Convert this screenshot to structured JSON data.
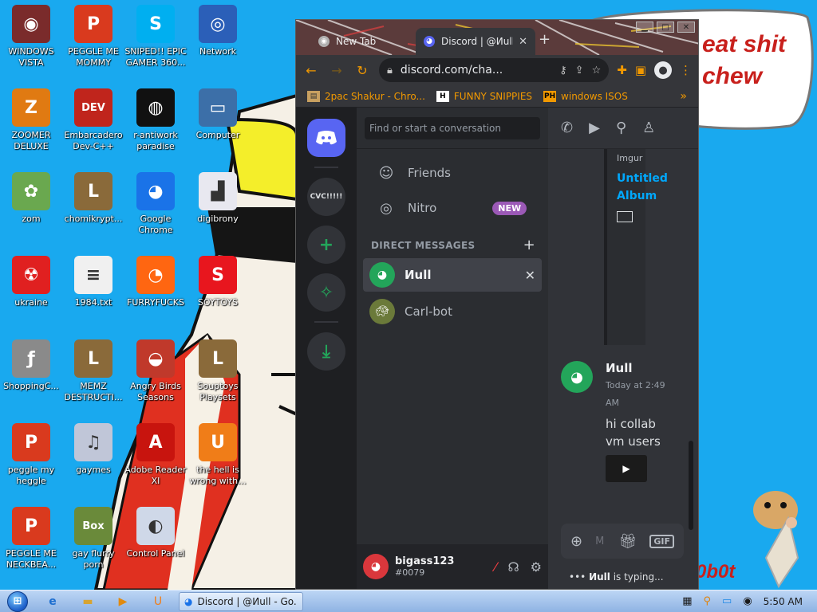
{
  "desktop_icons": [
    {
      "label": "WINDOWS VISTA",
      "icon": "vista-shell-icon",
      "glyph": "◉",
      "bg": "#7a2b2b"
    },
    {
      "label": "PEGGLE ME MOMMY",
      "icon": "peggle-icon",
      "glyph": "P",
      "bg": "#d93a1e"
    },
    {
      "label": "SNIPED!! EPIC GAMER 360...",
      "icon": "skype-icon",
      "glyph": "S",
      "bg": "#00aff0"
    },
    {
      "label": "Network",
      "icon": "network-globe-icon",
      "glyph": "◎",
      "bg": "#2b5fb8"
    },
    {
      "label": "ZOOMER DELUXE",
      "icon": "zoomer-icon",
      "glyph": "Z",
      "bg": "#e07a12"
    },
    {
      "label": "Embarcadero Dev-C++",
      "icon": "dev-cpp-icon",
      "glyph": "DEV",
      "bg": "#c0251c"
    },
    {
      "label": "r-antiwork paradise",
      "icon": "antiwork-icon",
      "glyph": "◍",
      "bg": "#111111"
    },
    {
      "label": "Computer",
      "icon": "computer-icon",
      "glyph": "▭",
      "bg": "#3c6fa8"
    },
    {
      "label": "zom",
      "icon": "flower-icon",
      "glyph": "✿",
      "bg": "#6aa84f"
    },
    {
      "label": "chomikrypt...",
      "icon": "shortcut-l-icon",
      "glyph": "L",
      "bg": "#8a6a3a"
    },
    {
      "label": "Google Chrome",
      "icon": "chrome-icon",
      "glyph": "◕",
      "bg": "#1a73e8"
    },
    {
      "label": "digibrony",
      "icon": "digibrony-icon",
      "glyph": "▟",
      "bg": "#e8e8f0"
    },
    {
      "label": "ukraine",
      "icon": "radiation-icon",
      "glyph": "☢",
      "bg": "#e02020"
    },
    {
      "label": "1984.txt",
      "icon": "text-file-icon",
      "glyph": "≡",
      "bg": "#f0f0f0"
    },
    {
      "label": "FURRYFUCKS",
      "icon": "firefox-icon",
      "glyph": "◔",
      "bg": "#ff6611"
    },
    {
      "label": "SOYTOYS",
      "icon": "soytoys-s-icon",
      "glyph": "S",
      "bg": "#e8161e"
    },
    {
      "label": "ShoppingC...",
      "icon": "flash-icon",
      "glyph": "ƒ",
      "bg": "#8a8a8a"
    },
    {
      "label": "MEMZ DESTRUCTI...",
      "icon": "shortcut-l-icon",
      "glyph": "L",
      "bg": "#8a6a3a"
    },
    {
      "label": "Angry Birds Seasons",
      "icon": "angry-birds-icon",
      "glyph": "◒",
      "bg": "#c0392b"
    },
    {
      "label": "Souptoys Playsets",
      "icon": "shortcut-l-icon",
      "glyph": "L",
      "bg": "#8a6a3a"
    },
    {
      "label": "peggle my heggle",
      "icon": "peggle-icon",
      "glyph": "P",
      "bg": "#d93a1e"
    },
    {
      "label": "gaymes",
      "icon": "media-files-icon",
      "glyph": "♫",
      "bg": "#c0c6d8"
    },
    {
      "label": "Adobe Reader XI",
      "icon": "adobe-reader-icon",
      "glyph": "A",
      "bg": "#c8140e"
    },
    {
      "label": "the hell is wrong with...",
      "icon": "uc-browser-icon",
      "glyph": "U",
      "bg": "#f07d18"
    },
    {
      "label": "PEGGLE ME NECKBEA...",
      "icon": "peggle-icon",
      "glyph": "P",
      "bg": "#d93a1e"
    },
    {
      "label": "gay flurry porn",
      "icon": "box-beaver-icon",
      "glyph": "Box",
      "bg": "#6a8a3a"
    },
    {
      "label": "Control Panel",
      "icon": "control-panel-icon",
      "glyph": "◐",
      "bg": "#cfd8e8"
    }
  ],
  "wallpaper": {
    "speech_text": "eat shit chew",
    "brand_text": "0b0t"
  },
  "browser": {
    "tabs": [
      {
        "label": "New Tab",
        "active": false
      },
      {
        "label": "Discord | @Иull",
        "active": true
      }
    ],
    "url": "discord.com/cha...",
    "bookmarks": [
      {
        "label": "2pac Shakur - Chro...",
        "icon": "bookmark-favicon-icon"
      },
      {
        "label": "FUNNY SNIPPIES",
        "icon": "h-favicon-icon"
      },
      {
        "label": "windows ISOS",
        "icon": "ph-favicon-icon"
      }
    ]
  },
  "discord": {
    "servers": [
      {
        "label": "CVC!!!!!"
      }
    ],
    "search_placeholder": "Find or start a conversation",
    "nav": [
      {
        "label": "Friends"
      },
      {
        "label": "Nitro",
        "badge": "NEW"
      }
    ],
    "dm_header": "DIRECT MESSAGES",
    "dms": [
      {
        "name": "Иull",
        "active": true
      },
      {
        "name": "Carl-bot",
        "active": false
      }
    ],
    "user": {
      "name": "bigass123",
      "tag": "#0079"
    },
    "embed": {
      "provider": "Imgur",
      "title": "Untitled Album"
    },
    "message": {
      "author": "Иull",
      "time": "Today at 2:49 AM",
      "text": "hi collab vm users"
    },
    "composer": {
      "placeholder": "M",
      "gif_label": "GIF"
    },
    "typing": {
      "user": "Иull",
      "suffix": "is typing..."
    }
  },
  "taskbar": {
    "active_task": "Discord | @Иull - Go...",
    "clock": "5:50 AM"
  }
}
